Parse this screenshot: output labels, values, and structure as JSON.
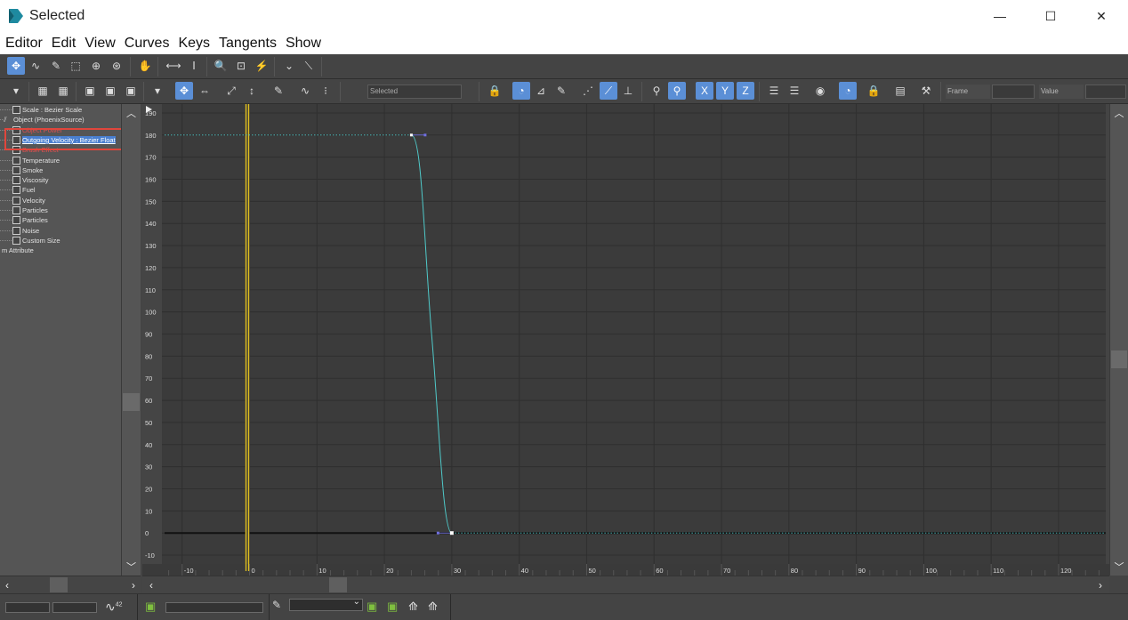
{
  "window": {
    "title": "Selected",
    "minimize_glyph": "—",
    "maximize_glyph": "☐",
    "close_glyph": "✕"
  },
  "menu": [
    "Editor",
    "Edit",
    "View",
    "Curves",
    "Keys",
    "Tangents",
    "Show"
  ],
  "toolbar2": {
    "selection_field": "Selected",
    "frame_label": "Frame",
    "value_label": "Value"
  },
  "tree": {
    "items": [
      {
        "label": "Scale : Bezier Scale",
        "indent": 2,
        "state": "normal",
        "icon": "scale-track-icon"
      },
      {
        "label": "Object (PhoenixSource)",
        "indent": 1,
        "state": "normal",
        "icon": "object-icon"
      },
      {
        "label": "Object Power",
        "indent": 3,
        "state": "red",
        "icon": "track-icon"
      },
      {
        "label": "Outgoing Velocity : Bezier Float",
        "indent": 3,
        "state": "selected",
        "icon": "track-icon"
      },
      {
        "label": "Brush Effect",
        "indent": 3,
        "state": "red",
        "icon": "track-icon"
      },
      {
        "label": "Temperature",
        "indent": 3,
        "state": "normal",
        "icon": "track-icon"
      },
      {
        "label": "Smoke",
        "indent": 3,
        "state": "normal",
        "icon": "track-icon"
      },
      {
        "label": "Viscosity",
        "indent": 3,
        "state": "normal",
        "icon": "track-icon"
      },
      {
        "label": "Fuel",
        "indent": 3,
        "state": "normal",
        "icon": "track-icon"
      },
      {
        "label": "Velocity",
        "indent": 3,
        "state": "normal",
        "icon": "track-icon"
      },
      {
        "label": "Particles",
        "indent": 3,
        "state": "normal",
        "icon": "track-icon"
      },
      {
        "label": "Particles",
        "indent": 3,
        "state": "normal",
        "icon": "track-icon"
      },
      {
        "label": "Noise",
        "indent": 3,
        "state": "normal",
        "icon": "track-icon"
      },
      {
        "label": "Custom Size",
        "indent": 3,
        "state": "normal",
        "icon": "track-icon"
      },
      {
        "label": "m Attribute",
        "indent": 0,
        "state": "normal",
        "icon": ""
      }
    ]
  },
  "graph": {
    "y_ticks": [
      190,
      180,
      170,
      160,
      150,
      140,
      130,
      120,
      110,
      100,
      90,
      80,
      70,
      60,
      50,
      40,
      30,
      20,
      10,
      0,
      -10
    ],
    "x_ticks": [
      -10,
      0,
      10,
      20,
      30,
      40,
      50,
      60,
      70,
      80,
      90,
      100,
      110,
      120
    ],
    "x_range": [
      -13,
      127
    ],
    "y_range": [
      -14,
      194
    ],
    "current_frame": 0,
    "curve_color": "#4fc9c9",
    "time_slider_color": "#e0c020",
    "keys": [
      {
        "frame": 24,
        "value": 180
      },
      {
        "frame": 30,
        "value": 0
      }
    ]
  },
  "status": {
    "zoom_label": "42"
  }
}
